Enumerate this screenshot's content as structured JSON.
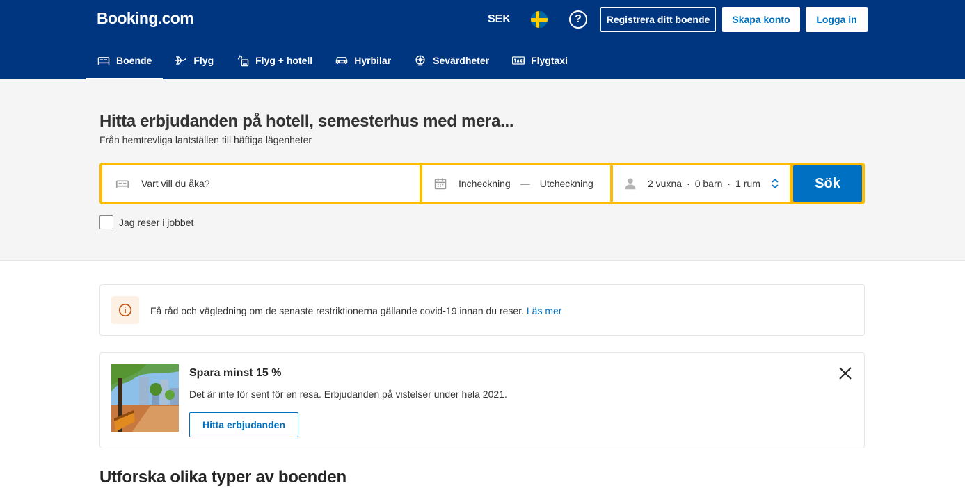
{
  "header": {
    "logo": "Booking.com",
    "currency": "SEK",
    "help_symbol": "?",
    "register_label": "Registrera ditt boende",
    "create_account_label": "Skapa konto",
    "login_label": "Logga in",
    "brand_color": "#003580"
  },
  "nav": {
    "items": [
      {
        "label": "Boende",
        "icon": "bed-icon",
        "active": true
      },
      {
        "label": "Flyg",
        "icon": "plane-icon"
      },
      {
        "label": "Flyg + hotell",
        "icon": "flight-hotel-icon"
      },
      {
        "label": "Hyrbilar",
        "icon": "car-icon"
      },
      {
        "label": "Sevärdheter",
        "icon": "attractions-icon"
      },
      {
        "label": "Flygtaxi",
        "icon": "taxi-icon"
      }
    ]
  },
  "hero": {
    "title": "Hitta erbjudanden på hotell, semesterhus med mera...",
    "subtitle": "Från hemtrevliga lantställen till häftiga lägenheter"
  },
  "search": {
    "destination_placeholder": "Vart vill du åka?",
    "checkin_label": "Incheckning",
    "checkout_label": "Utcheckning",
    "adults": "2 vuxna",
    "children": "0 barn",
    "rooms": "1 rum",
    "submit_label": "Sök",
    "accent_color": "#febb02",
    "button_color": "#0071c2"
  },
  "business_travel": {
    "label": "Jag reser i jobbet",
    "checked": false
  },
  "covid_notice": {
    "text": "Få råd och vägledning om de senaste restriktionerna gällande covid-19 innan du reser.",
    "link_text": "Läs mer"
  },
  "promo": {
    "title": "Spara minst 15 %",
    "text": "Det är inte för sent för en resa. Erbjudanden på vistelser under hela 2021.",
    "button_label": "Hitta erbjudanden"
  },
  "explore": {
    "title": "Utforska olika typer av boenden"
  }
}
